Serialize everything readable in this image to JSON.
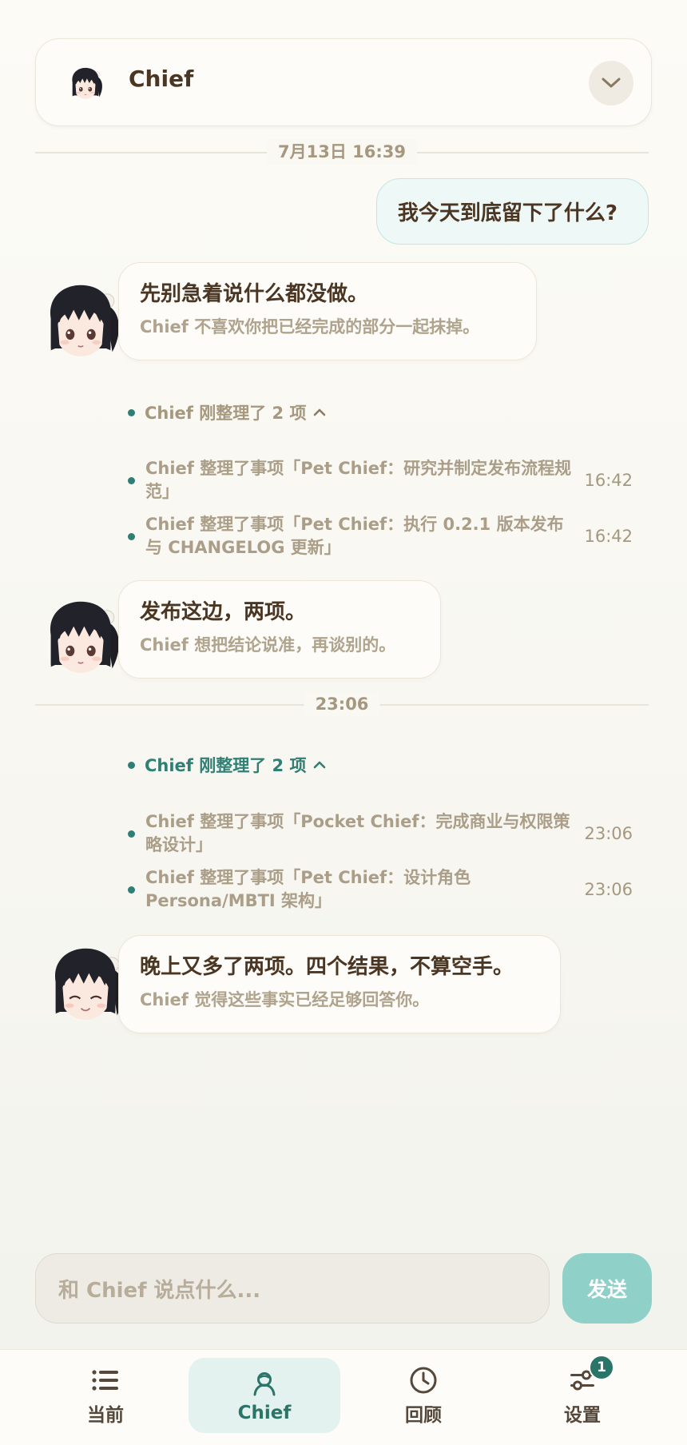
{
  "header": {
    "title": "Chief"
  },
  "dividers": {
    "first": "7月13日 16:39",
    "second": "23:06"
  },
  "user_message": "我今天到底留下了什么?",
  "messages": [
    {
      "main": "先别急着说什么都没做。",
      "sub": "Chief 不喜欢你把已经完成的部分一起抹掉。"
    },
    {
      "main": "发布这边，两项。",
      "sub": "Chief 想把结论说准，再谈别的。"
    },
    {
      "main": "晚上又多了两项。四个结果，不算空手。",
      "sub": "Chief 觉得这些事实已经足够回答你。"
    }
  ],
  "summaries": [
    {
      "head": "Chief 刚整理了 2 项",
      "items": [
        {
          "text": "Chief 整理了事项「Pet Chief：研究并制定发布流程规范」",
          "time": "16:42"
        },
        {
          "text": "Chief 整理了事项「Pet Chief：执行 0.2.1 版本发布与 CHANGELOG 更新」",
          "time": "16:42"
        }
      ]
    },
    {
      "head": "Chief 刚整理了 2 项",
      "items": [
        {
          "text": "Chief 整理了事项「Pocket Chief：完成商业与权限策略设计」",
          "time": "23:06"
        },
        {
          "text": "Chief 整理了事项「Pet Chief：设计角色 Persona/MBTI 架构」",
          "time": "23:06"
        }
      ]
    }
  ],
  "composer": {
    "placeholder": "和 Chief 说点什么...",
    "send_label": "发送"
  },
  "tabs": [
    {
      "label": "当前",
      "icon": "list-icon"
    },
    {
      "label": "Chief",
      "icon": "person-icon",
      "active": true
    },
    {
      "label": "回顾",
      "icon": "clock-icon"
    },
    {
      "label": "设置",
      "icon": "sliders-icon",
      "badge": "1"
    }
  ],
  "colors": {
    "accent": "#2b7468",
    "send": "#8fd0c8",
    "user_bubble": "#eef8f6"
  }
}
